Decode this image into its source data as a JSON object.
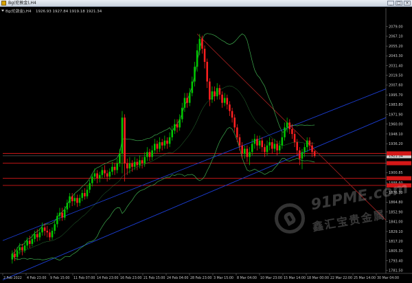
{
  "window": {
    "title": "Bg(伦敦金),H4",
    "minimize_label": "_",
    "maximize_label": "□",
    "close_label": "×"
  },
  "chart_header": {
    "symbol": "Bg(伦敦金),H4",
    "ohlc": "1926.93 1927.84 1919.18 1921.34"
  },
  "chart_data": {
    "type": "candlestick",
    "instrument": "Bg(伦敦金)",
    "timeframe": "H4",
    "last_ohlc": {
      "open": 1926.93,
      "high": 1927.84,
      "low": 1919.18,
      "close": 1921.34
    },
    "ylim": [
      1778,
      2093
    ],
    "price_ticks": [
      2079.0,
      2067.1,
      2055.2,
      2043.3,
      2031.4,
      2019.5,
      2007.6,
      1995.7,
      1983.8,
      1971.9,
      1960.0,
      1948.1,
      1936.2,
      1924.3,
      1912.4,
      1900.85,
      1888.6,
      1876.7,
      1864.8,
      1852.9,
      1841.0,
      1829.1,
      1817.2,
      1805.3,
      1793.4,
      1781.5
    ],
    "time_labels": [
      "2 Feb 2022",
      "4 Feb 23:00",
      "9 Feb 15:00",
      "11 Feb 07:00",
      "14 Feb 23:00",
      "16 Feb 23:00",
      "21 Feb 15:00",
      "24 Feb 04:00",
      "28 Feb 23:00",
      "3 Mar 15:00",
      "8 Mar 04:00",
      "10 Mar 23:00",
      "15 Mar 14:00",
      "18 Mar 00:00",
      "22 Mar 22:00",
      "25 Mar 14:00",
      "30 Mar 04:00"
    ],
    "current_price": 1921.34,
    "horizontal_lines": [
      1924.3,
      1912.4,
      1894.0,
      1885.3
    ],
    "candles": [
      {
        "o": 1795,
        "c": 1802,
        "h": 1806,
        "l": 1790
      },
      {
        "o": 1802,
        "c": 1798,
        "h": 1808,
        "l": 1793
      },
      {
        "o": 1798,
        "c": 1806,
        "h": 1810,
        "l": 1794
      },
      {
        "o": 1806,
        "c": 1810,
        "h": 1815,
        "l": 1801
      },
      {
        "o": 1810,
        "c": 1806,
        "h": 1814,
        "l": 1800
      },
      {
        "o": 1806,
        "c": 1812,
        "h": 1818,
        "l": 1803
      },
      {
        "o": 1812,
        "c": 1818,
        "h": 1822,
        "l": 1808
      },
      {
        "o": 1818,
        "c": 1814,
        "h": 1824,
        "l": 1809
      },
      {
        "o": 1814,
        "c": 1820,
        "h": 1826,
        "l": 1811
      },
      {
        "o": 1820,
        "c": 1826,
        "h": 1830,
        "l": 1816
      },
      {
        "o": 1826,
        "c": 1822,
        "h": 1832,
        "l": 1817
      },
      {
        "o": 1822,
        "c": 1828,
        "h": 1833,
        "l": 1818
      },
      {
        "o": 1828,
        "c": 1834,
        "h": 1840,
        "l": 1824
      },
      {
        "o": 1834,
        "c": 1830,
        "h": 1839,
        "l": 1824
      },
      {
        "o": 1830,
        "c": 1828,
        "h": 1836,
        "l": 1822
      },
      {
        "o": 1828,
        "c": 1822,
        "h": 1832,
        "l": 1818
      },
      {
        "o": 1822,
        "c": 1830,
        "h": 1834,
        "l": 1819
      },
      {
        "o": 1830,
        "c": 1838,
        "h": 1842,
        "l": 1826
      },
      {
        "o": 1838,
        "c": 1848,
        "h": 1852,
        "l": 1834
      },
      {
        "o": 1848,
        "c": 1852,
        "h": 1858,
        "l": 1842
      },
      {
        "o": 1852,
        "c": 1846,
        "h": 1858,
        "l": 1842
      },
      {
        "o": 1846,
        "c": 1856,
        "h": 1860,
        "l": 1843
      },
      {
        "o": 1856,
        "c": 1864,
        "h": 1868,
        "l": 1852
      },
      {
        "o": 1864,
        "c": 1872,
        "h": 1876,
        "l": 1858
      },
      {
        "o": 1872,
        "c": 1866,
        "h": 1876,
        "l": 1860
      },
      {
        "o": 1866,
        "c": 1870,
        "h": 1875,
        "l": 1861
      },
      {
        "o": 1870,
        "c": 1864,
        "h": 1874,
        "l": 1859
      },
      {
        "o": 1864,
        "c": 1870,
        "h": 1874,
        "l": 1860
      },
      {
        "o": 1870,
        "c": 1876,
        "h": 1880,
        "l": 1866
      },
      {
        "o": 1876,
        "c": 1872,
        "h": 1882,
        "l": 1868
      },
      {
        "o": 1872,
        "c": 1880,
        "h": 1886,
        "l": 1869
      },
      {
        "o": 1880,
        "c": 1888,
        "h": 1892,
        "l": 1876
      },
      {
        "o": 1888,
        "c": 1896,
        "h": 1900,
        "l": 1884
      },
      {
        "o": 1896,
        "c": 1900,
        "h": 1906,
        "l": 1891
      },
      {
        "o": 1900,
        "c": 1894,
        "h": 1904,
        "l": 1888
      },
      {
        "o": 1894,
        "c": 1898,
        "h": 1902,
        "l": 1889
      },
      {
        "o": 1898,
        "c": 1904,
        "h": 1908,
        "l": 1894
      },
      {
        "o": 1904,
        "c": 1900,
        "h": 1910,
        "l": 1895
      },
      {
        "o": 1900,
        "c": 1896,
        "h": 1904,
        "l": 1890
      },
      {
        "o": 1896,
        "c": 1902,
        "h": 1906,
        "l": 1892
      },
      {
        "o": 1902,
        "c": 1908,
        "h": 1914,
        "l": 1898
      },
      {
        "o": 1908,
        "c": 1904,
        "h": 1912,
        "l": 1898
      },
      {
        "o": 1904,
        "c": 1912,
        "h": 1918,
        "l": 1900
      },
      {
        "o": 1912,
        "c": 1924,
        "h": 1930,
        "l": 1908
      },
      {
        "o": 1924,
        "c": 1968,
        "h": 1976,
        "l": 1900
      },
      {
        "o": 1968,
        "c": 1912,
        "h": 1972,
        "l": 1890
      },
      {
        "o": 1912,
        "c": 1906,
        "h": 1918,
        "l": 1898
      },
      {
        "o": 1906,
        "c": 1912,
        "h": 1920,
        "l": 1900
      },
      {
        "o": 1912,
        "c": 1908,
        "h": 1916,
        "l": 1902
      },
      {
        "o": 1908,
        "c": 1914,
        "h": 1920,
        "l": 1904
      },
      {
        "o": 1914,
        "c": 1910,
        "h": 1918,
        "l": 1904
      },
      {
        "o": 1910,
        "c": 1916,
        "h": 1922,
        "l": 1906
      },
      {
        "o": 1916,
        "c": 1912,
        "h": 1920,
        "l": 1906
      },
      {
        "o": 1912,
        "c": 1920,
        "h": 1926,
        "l": 1908
      },
      {
        "o": 1920,
        "c": 1926,
        "h": 1932,
        "l": 1915
      },
      {
        "o": 1926,
        "c": 1920,
        "h": 1930,
        "l": 1915
      },
      {
        "o": 1920,
        "c": 1928,
        "h": 1934,
        "l": 1916
      },
      {
        "o": 1928,
        "c": 1936,
        "h": 1942,
        "l": 1924
      },
      {
        "o": 1936,
        "c": 1930,
        "h": 1940,
        "l": 1925
      },
      {
        "o": 1930,
        "c": 1938,
        "h": 1944,
        "l": 1926
      },
      {
        "o": 1938,
        "c": 1934,
        "h": 1942,
        "l": 1928
      },
      {
        "o": 1934,
        "c": 1940,
        "h": 1946,
        "l": 1930
      },
      {
        "o": 1940,
        "c": 1936,
        "h": 1944,
        "l": 1930
      },
      {
        "o": 1936,
        "c": 1944,
        "h": 1950,
        "l": 1932
      },
      {
        "o": 1944,
        "c": 1952,
        "h": 1958,
        "l": 1940
      },
      {
        "o": 1952,
        "c": 1960,
        "h": 1966,
        "l": 1948
      },
      {
        "o": 1960,
        "c": 1956,
        "h": 1966,
        "l": 1950
      },
      {
        "o": 1956,
        "c": 1966,
        "h": 1972,
        "l": 1952
      },
      {
        "o": 1966,
        "c": 1980,
        "h": 1986,
        "l": 1962
      },
      {
        "o": 1980,
        "c": 1992,
        "h": 1998,
        "l": 1975
      },
      {
        "o": 1992,
        "c": 1986,
        "h": 1998,
        "l": 1980
      },
      {
        "o": 1986,
        "c": 1998,
        "h": 2004,
        "l": 1982
      },
      {
        "o": 1998,
        "c": 2012,
        "h": 2018,
        "l": 1994
      },
      {
        "o": 2012,
        "c": 2030,
        "h": 2036,
        "l": 2006
      },
      {
        "o": 2030,
        "c": 2050,
        "h": 2058,
        "l": 2024
      },
      {
        "o": 2050,
        "c": 2064,
        "h": 2070,
        "l": 2044
      },
      {
        "o": 2064,
        "c": 2052,
        "h": 2068,
        "l": 2046
      },
      {
        "o": 2052,
        "c": 2036,
        "h": 2056,
        "l": 2028
      },
      {
        "o": 2036,
        "c": 2012,
        "h": 2040,
        "l": 2004
      },
      {
        "o": 2012,
        "c": 1990,
        "h": 2016,
        "l": 1982
      },
      {
        "o": 1990,
        "c": 2000,
        "h": 2006,
        "l": 1986
      },
      {
        "o": 2000,
        "c": 1994,
        "h": 2006,
        "l": 1988
      },
      {
        "o": 1994,
        "c": 2004,
        "h": 2010,
        "l": 1990
      },
      {
        "o": 2004,
        "c": 1996,
        "h": 2008,
        "l": 1990
      },
      {
        "o": 1996,
        "c": 1986,
        "h": 2000,
        "l": 1980
      },
      {
        "o": 1986,
        "c": 1992,
        "h": 1998,
        "l": 1982
      },
      {
        "o": 1992,
        "c": 1984,
        "h": 1996,
        "l": 1978
      },
      {
        "o": 1984,
        "c": 1976,
        "h": 1988,
        "l": 1970
      },
      {
        "o": 1976,
        "c": 1968,
        "h": 1980,
        "l": 1962
      },
      {
        "o": 1968,
        "c": 1956,
        "h": 1972,
        "l": 1950
      },
      {
        "o": 1956,
        "c": 1944,
        "h": 1960,
        "l": 1938
      },
      {
        "o": 1944,
        "c": 1934,
        "h": 1948,
        "l": 1928
      },
      {
        "o": 1934,
        "c": 1924,
        "h": 1938,
        "l": 1918
      },
      {
        "o": 1924,
        "c": 1930,
        "h": 1934,
        "l": 1918
      },
      {
        "o": 1930,
        "c": 1920,
        "h": 1934,
        "l": 1914
      },
      {
        "o": 1920,
        "c": 1926,
        "h": 1932,
        "l": 1910
      },
      {
        "o": 1926,
        "c": 1936,
        "h": 1942,
        "l": 1922
      },
      {
        "o": 1936,
        "c": 1942,
        "h": 1948,
        "l": 1930
      },
      {
        "o": 1942,
        "c": 1934,
        "h": 1946,
        "l": 1928
      },
      {
        "o": 1934,
        "c": 1940,
        "h": 1946,
        "l": 1930
      },
      {
        "o": 1940,
        "c": 1932,
        "h": 1944,
        "l": 1926
      },
      {
        "o": 1932,
        "c": 1926,
        "h": 1936,
        "l": 1920
      },
      {
        "o": 1926,
        "c": 1934,
        "h": 1940,
        "l": 1922
      },
      {
        "o": 1934,
        "c": 1938,
        "h": 1944,
        "l": 1928
      },
      {
        "o": 1938,
        "c": 1930,
        "h": 1942,
        "l": 1924
      },
      {
        "o": 1930,
        "c": 1936,
        "h": 1942,
        "l": 1926
      },
      {
        "o": 1936,
        "c": 1928,
        "h": 1940,
        "l": 1922
      },
      {
        "o": 1928,
        "c": 1934,
        "h": 1940,
        "l": 1924
      },
      {
        "o": 1934,
        "c": 1944,
        "h": 1950,
        "l": 1930
      },
      {
        "o": 1944,
        "c": 1956,
        "h": 1962,
        "l": 1940
      },
      {
        "o": 1956,
        "c": 1962,
        "h": 1968,
        "l": 1950
      },
      {
        "o": 1962,
        "c": 1954,
        "h": 1966,
        "l": 1948
      },
      {
        "o": 1954,
        "c": 1948,
        "h": 1960,
        "l": 1942
      },
      {
        "o": 1948,
        "c": 1938,
        "h": 1952,
        "l": 1932
      },
      {
        "o": 1938,
        "c": 1928,
        "h": 1942,
        "l": 1922
      },
      {
        "o": 1928,
        "c": 1918,
        "h": 1932,
        "l": 1910
      },
      {
        "o": 1918,
        "c": 1926,
        "h": 1930,
        "l": 1905
      },
      {
        "o": 1926,
        "c": 1932,
        "h": 1936,
        "l": 1920
      },
      {
        "o": 1932,
        "c": 1940,
        "h": 1944,
        "l": 1926
      },
      {
        "o": 1940,
        "c": 1934,
        "h": 1944,
        "l": 1928
      },
      {
        "o": 1934,
        "c": 1926,
        "h": 1938,
        "l": 1920
      },
      {
        "o": 1926.93,
        "c": 1921.34,
        "h": 1927.84,
        "l": 1919.18
      }
    ],
    "colors": {
      "background": "#000000",
      "bull": "#00c800",
      "bear": "#ff2020",
      "bands": "#3fae4f",
      "channel": "#1c3ed6",
      "trendline": "#9a1e1e",
      "hline": "#d41818",
      "axis_text": "#c8c8c8"
    }
  },
  "watermark": {
    "brand": "91PME.com",
    "chinese": "鑫汇宝贵金属"
  }
}
